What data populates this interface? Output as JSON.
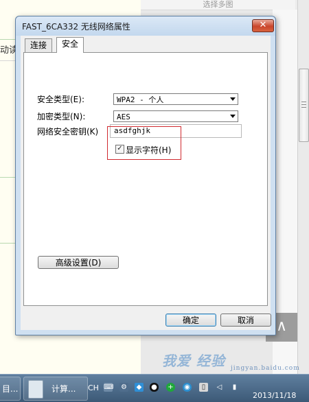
{
  "background": {
    "header_text": "选择多图",
    "peek_text": "动读",
    "scroll_top_label": "∧",
    "watermark_text": "我爱 经验",
    "watermark_url": "jingyan.baidu.com"
  },
  "dialog": {
    "title": "FAST_6CA332 无线网络属性",
    "close_label": "✕",
    "tabs": [
      {
        "label": "连接"
      },
      {
        "label": "安全"
      }
    ],
    "security_type_label": "安全类型(E):",
    "security_type_value": "WPA2 - 个人",
    "encryption_type_label": "加密类型(N):",
    "encryption_type_value": "AES",
    "key_label": "网络安全密钥(K)",
    "key_value": "asdfghjk",
    "show_chars_label": "显示字符(H)",
    "show_chars_checked": true,
    "advanced_label": "高级设置(D)",
    "ok_label": "确定",
    "cancel_label": "取消"
  },
  "taskbar": {
    "left_item": "目...",
    "calculator_label": "计算...",
    "input_method": "CH",
    "date": "2013/11/18"
  },
  "colors": {
    "close_red": "#c9462c",
    "highlight_red": "#d0282e",
    "taskbar": "#3b5875"
  }
}
